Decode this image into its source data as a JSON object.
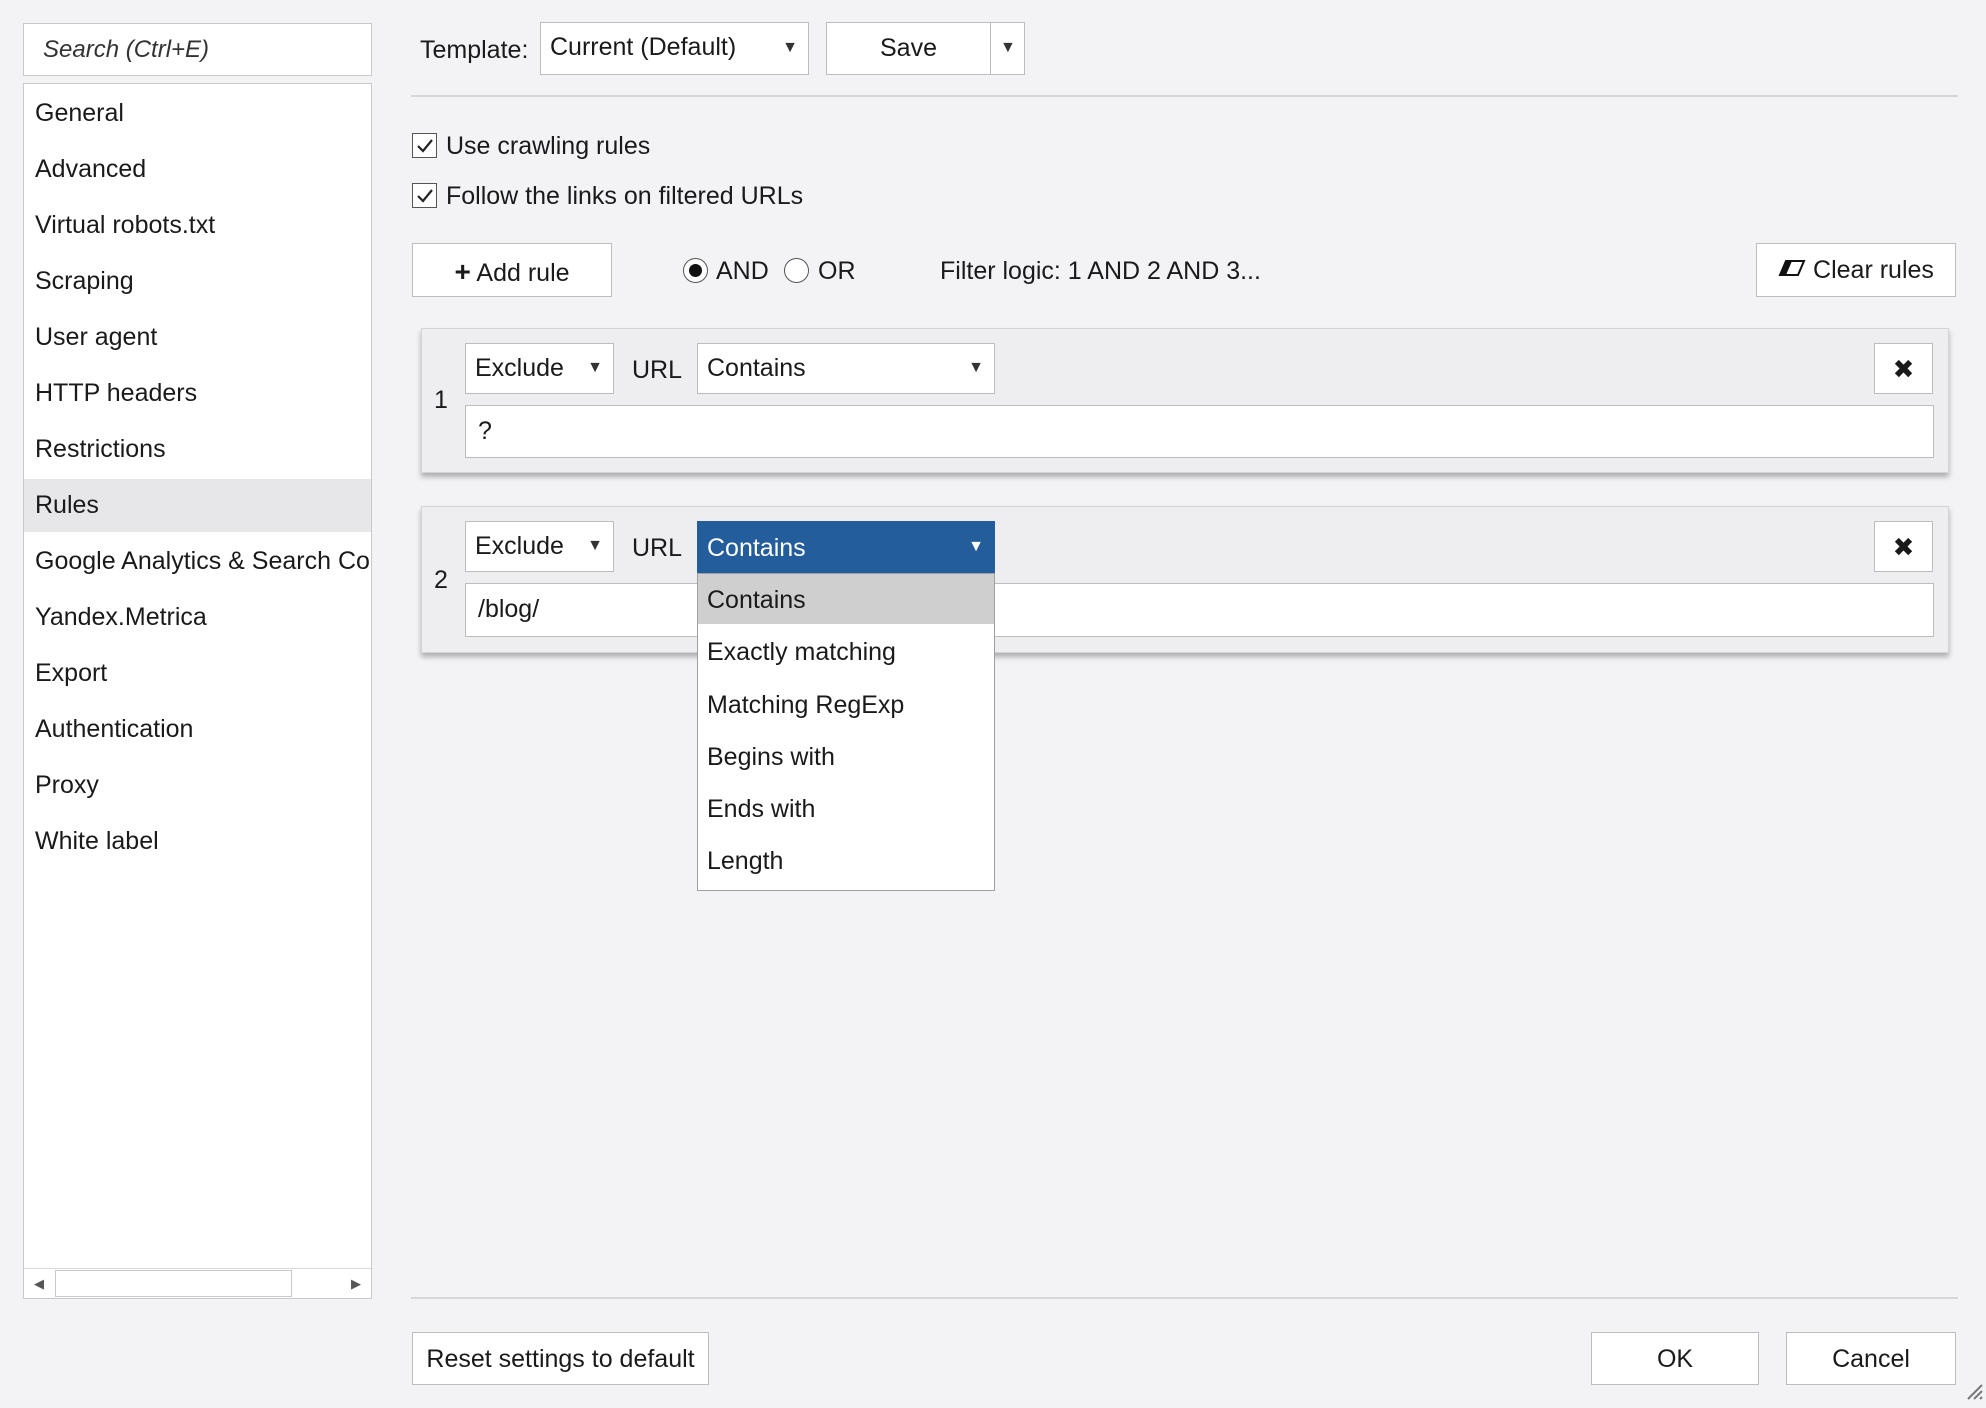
{
  "sidebar": {
    "search_placeholder": "Search (Ctrl+E)",
    "items": [
      {
        "label": "General"
      },
      {
        "label": "Advanced"
      },
      {
        "label": "Virtual robots.txt"
      },
      {
        "label": "Scraping"
      },
      {
        "label": "User agent"
      },
      {
        "label": "HTTP headers"
      },
      {
        "label": "Restrictions"
      },
      {
        "label": "Rules",
        "selected": true
      },
      {
        "label": "Google Analytics & Search Console"
      },
      {
        "label": "Yandex.Metrica"
      },
      {
        "label": "Export"
      },
      {
        "label": "Authentication"
      },
      {
        "label": "Proxy"
      },
      {
        "label": "White label"
      }
    ]
  },
  "toolbar": {
    "template_label": "Template:",
    "template_value": "Current (Default)",
    "save_label": "Save"
  },
  "options": {
    "use_crawling_rules": {
      "label": "Use crawling rules",
      "checked": true
    },
    "follow_links": {
      "label": "Follow the links on filtered URLs",
      "checked": true
    }
  },
  "rules_bar": {
    "add_rule_label": "Add rule",
    "and_label": "AND",
    "or_label": "OR",
    "logic_selected": "AND",
    "filter_logic": "Filter logic: 1 AND 2 AND 3...",
    "clear_rules_label": "Clear rules"
  },
  "rules": [
    {
      "number": "1",
      "action": "Exclude",
      "field": "URL",
      "condition": "Contains",
      "value": "?"
    },
    {
      "number": "2",
      "action": "Exclude",
      "field": "URL",
      "condition": "Contains",
      "value": "/blog/"
    }
  ],
  "condition_dropdown": {
    "options": [
      "Contains",
      "Exactly matching",
      "Matching RegExp",
      "Begins with",
      "Ends with",
      "Length"
    ],
    "highlighted": "Contains"
  },
  "footer": {
    "reset_label": "Reset settings to default",
    "ok_label": "OK",
    "cancel_label": "Cancel"
  },
  "colors": {
    "accent": "#245d9c",
    "background": "#f3f2f5",
    "selected_item": "#e7e6e9"
  }
}
